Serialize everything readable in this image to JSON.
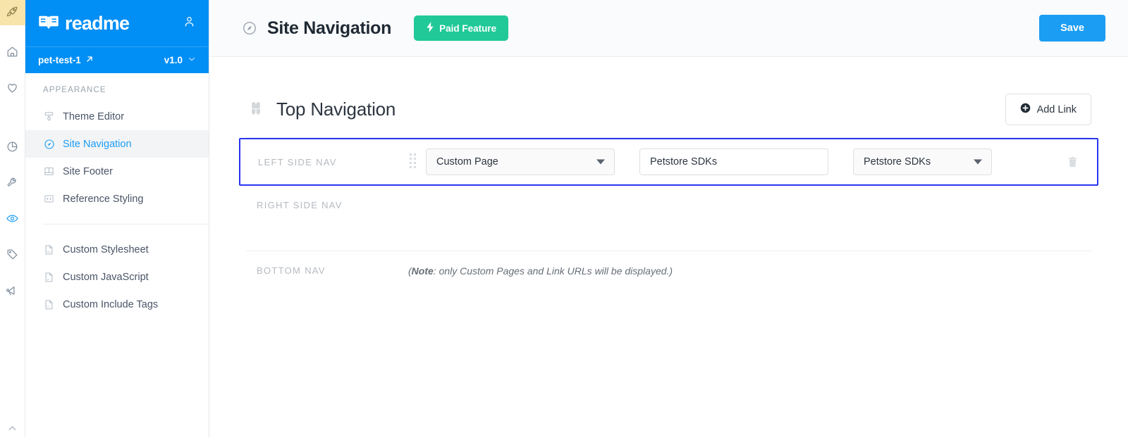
{
  "brand": {
    "name": "readme",
    "logo_icon": "book-icon",
    "account_icon": "person-icon"
  },
  "project": {
    "name": "pet-test-1",
    "external_link_icon": "external-link-arrow-icon",
    "version": "v1.0",
    "version_caret_icon": "chevron-down-icon"
  },
  "rail": {
    "items": [
      {
        "name": "rocket",
        "icon": "rocket-icon",
        "state": "highlighted"
      },
      {
        "name": "home",
        "icon": "home-icon",
        "state": "default"
      },
      {
        "name": "favorites",
        "icon": "heart-icon",
        "state": "default"
      },
      {
        "name": "metrics",
        "icon": "pie-chart-icon",
        "state": "default"
      },
      {
        "name": "settings",
        "icon": "wrench-icon",
        "state": "default"
      },
      {
        "name": "appearance",
        "icon": "eye-icon",
        "state": "active"
      },
      {
        "name": "tags",
        "icon": "tag-icon",
        "state": "default"
      },
      {
        "name": "announcements",
        "icon": "megaphone-icon",
        "state": "default"
      }
    ]
  },
  "sidebar": {
    "section_title": "Appearance",
    "items": [
      {
        "label": "Theme Editor",
        "icon": "paint-roller-icon",
        "selected": false
      },
      {
        "label": "Site Navigation",
        "icon": "compass-icon",
        "selected": true
      },
      {
        "label": "Site Footer",
        "icon": "footer-layout-icon",
        "selected": false
      },
      {
        "label": "Reference Styling",
        "icon": "code-brackets-icon",
        "selected": false
      }
    ],
    "items_secondary": [
      {
        "label": "Custom Stylesheet",
        "icon": "file-css-icon"
      },
      {
        "label": "Custom JavaScript",
        "icon": "file-js-icon"
      },
      {
        "label": "Custom Include Tags",
        "icon": "file-code-icon"
      }
    ]
  },
  "header": {
    "icon": "compass-icon",
    "title": "Site Navigation",
    "badge": {
      "label": "Paid Feature",
      "icon": "lightning-bolt-icon",
      "color": "#20c997"
    },
    "save_label": "Save",
    "save_color": "#1b9df3"
  },
  "section": {
    "icon": "binoculars-icon",
    "title": "Top Navigation",
    "add_link_label": "Add Link",
    "add_link_icon": "circle-plus-icon"
  },
  "groups": [
    {
      "label": "Left Side Nav",
      "highlighted": true,
      "highlight_color": "#2b35f0",
      "rows": [
        {
          "drag_handle_icon": "drag-grip-icon",
          "type_select": "Custom Page",
          "label_input_value": "Petstore SDKs",
          "target_select": "Petstore SDKs",
          "delete_icon": "trash-icon"
        }
      ]
    },
    {
      "label": "Right Side Nav",
      "highlighted": false,
      "rows": []
    },
    {
      "label": "Bottom Nav",
      "highlighted": false,
      "rows": [],
      "note_prefix": "(",
      "note_bold": "Note",
      "note_rest": ": only Custom Pages and Link URLs will be displayed.)"
    }
  ]
}
